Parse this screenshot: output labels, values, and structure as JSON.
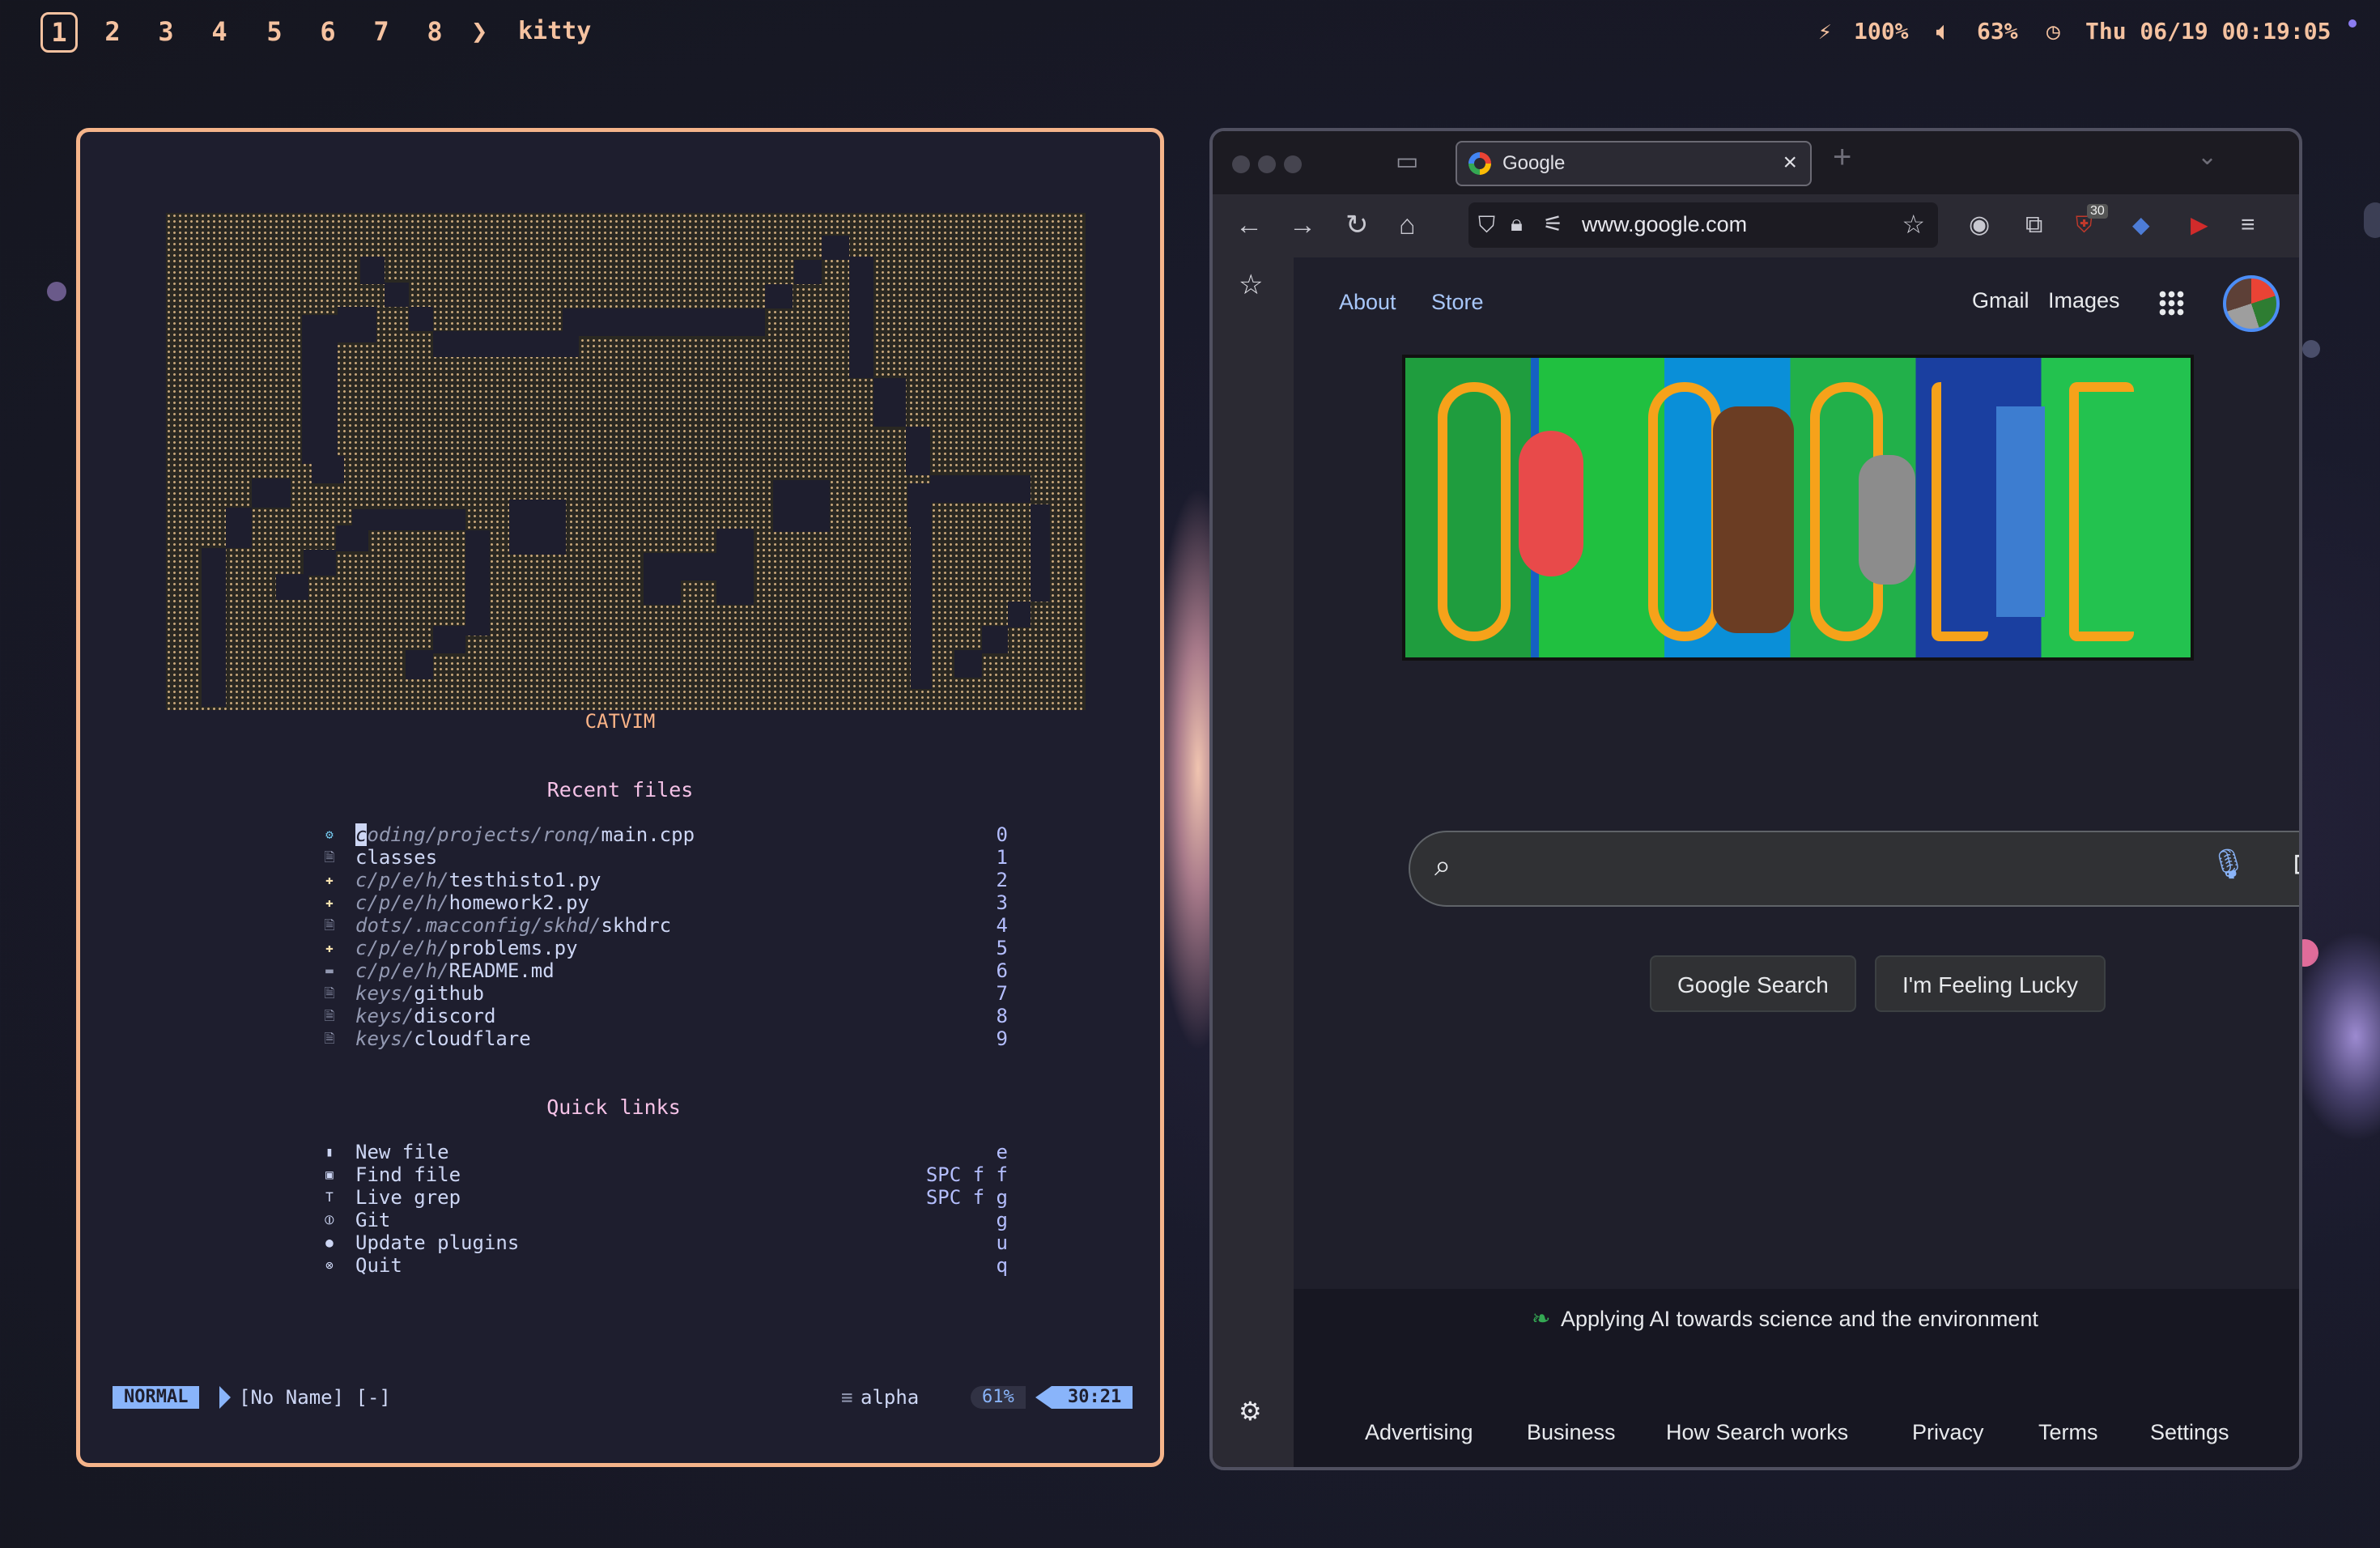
{
  "topbar": {
    "workspaces": [
      "1",
      "2",
      "3",
      "4",
      "5",
      "6",
      "7",
      "8"
    ],
    "active_workspace": "1",
    "chevron": "❯",
    "app_title": "kitty",
    "battery": "100%",
    "battery_icon": "lightning-icon",
    "volume": "63%",
    "volume_icon": "speaker-icon",
    "clock": "Thu 06/19 00:19:05",
    "clock_icon": "clock-icon"
  },
  "terminal": {
    "banner_label": "CATVIM",
    "recent_title": "Recent files",
    "recent": [
      {
        "dir": "coding/projects/ronq/",
        "file": "main.cpp",
        "key": "0",
        "icon": "c++-icon"
      },
      {
        "dir": "",
        "file": "classes",
        "key": "1",
        "icon": "file-icon"
      },
      {
        "dir": "c/p/e/h/",
        "file": "testhisto1.py",
        "key": "2",
        "icon": "python-icon"
      },
      {
        "dir": "c/p/e/h/",
        "file": "homework2.py",
        "key": "3",
        "icon": "python-icon"
      },
      {
        "dir": "dots/.macconfig/skhd/",
        "file": "skhdrc",
        "key": "4",
        "icon": "file-icon"
      },
      {
        "dir": "c/p/e/h/",
        "file": "problems.py",
        "key": "5",
        "icon": "python-icon"
      },
      {
        "dir": "c/p/e/h/",
        "file": "README.md",
        "key": "6",
        "icon": "markdown-icon"
      },
      {
        "dir": "keys/",
        "file": "github",
        "key": "7",
        "icon": "file-icon"
      },
      {
        "dir": "keys/",
        "file": "discord",
        "key": "8",
        "icon": "file-icon"
      },
      {
        "dir": "keys/",
        "file": "cloudflare",
        "key": "9",
        "icon": "file-icon"
      }
    ],
    "quick_title": "Quick links",
    "quick": [
      {
        "label": "New file",
        "key": "e",
        "icon": "new-file-icon"
      },
      {
        "label": "Find file",
        "key": "SPC f f",
        "icon": "find-file-icon"
      },
      {
        "label": "Live grep",
        "key": "SPC f g",
        "icon": "text-icon"
      },
      {
        "label": "Git",
        "key": "g",
        "icon": "git-icon"
      },
      {
        "label": "Update plugins",
        "key": "u",
        "icon": "update-icon"
      },
      {
        "label": "Quit",
        "key": "q",
        "icon": "quit-icon"
      }
    ],
    "status": {
      "mode": "NORMAL",
      "filename": "[No Name] [-]",
      "filetype": "alpha",
      "percent": "61%",
      "position": "30:21"
    }
  },
  "browser": {
    "tab_title": "Google",
    "url": "www.google.com",
    "extension_badge": "30",
    "google": {
      "about": "About",
      "store": "Store",
      "gmail": "Gmail",
      "images": "Images",
      "search_button": "Google Search",
      "lucky_button": "I'm Feeling Lucky",
      "promo": "Applying AI towards science and the environment",
      "footer_links": [
        "Advertising",
        "Business",
        "How Search works",
        "Privacy",
        "Terms",
        "Settings"
      ]
    }
  },
  "colors": {
    "accent_peach": "#f5b48a",
    "terminal_bg": "#1e1e2e",
    "mode_blue": "#89b4fa",
    "google_link": "#a8c7fa"
  }
}
